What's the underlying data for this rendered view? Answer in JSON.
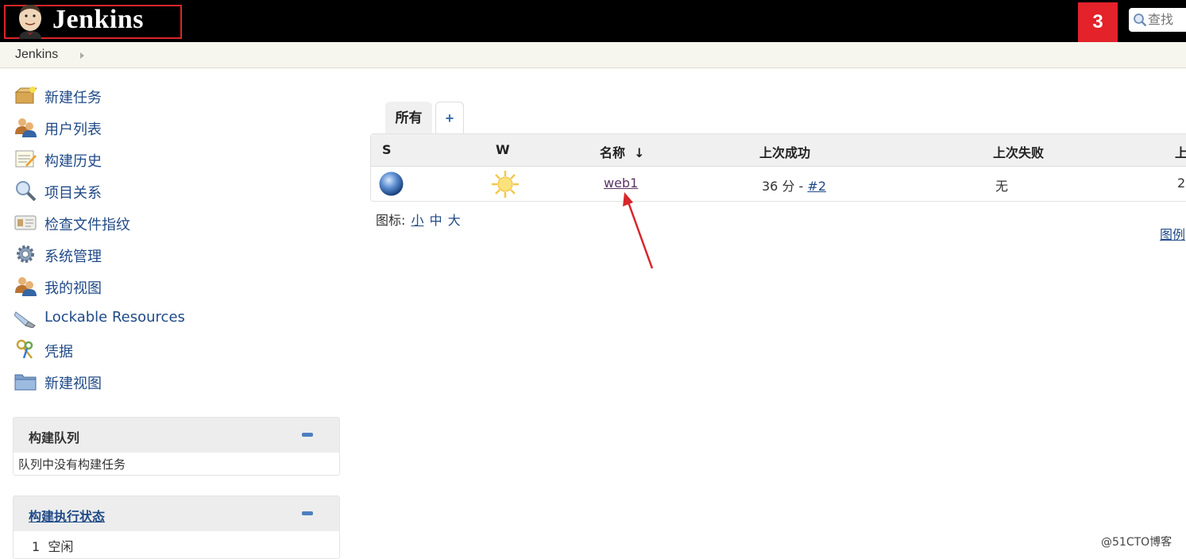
{
  "header": {
    "logo_text": "Jenkins",
    "notification_count": "3",
    "search_placeholder": "查找"
  },
  "breadcrumb": {
    "items": [
      "Jenkins"
    ]
  },
  "sidebar": {
    "items": [
      {
        "label": "新建任务",
        "icon": "new-item-icon"
      },
      {
        "label": "用户列表",
        "icon": "users-icon"
      },
      {
        "label": "构建历史",
        "icon": "build-history-icon"
      },
      {
        "label": "项目关系",
        "icon": "magnifier-icon"
      },
      {
        "label": "检查文件指纹",
        "icon": "fingerprint-card-icon"
      },
      {
        "label": "系统管理",
        "icon": "gear-icon"
      },
      {
        "label": "我的视图",
        "icon": "my-views-icon"
      },
      {
        "label": "Lockable Resources",
        "icon": "usb-drive-icon"
      },
      {
        "label": "凭据",
        "icon": "credentials-keys-icon"
      },
      {
        "label": "新建视图",
        "icon": "folder-icon"
      }
    ]
  },
  "build_queue": {
    "title": "构建队列",
    "empty_text": "队列中没有构建任务"
  },
  "executor_status": {
    "title": "构建执行状态",
    "executors": [
      {
        "number": "1",
        "state": "空闲"
      }
    ]
  },
  "view_tabs": {
    "active": "所有",
    "add": "+"
  },
  "job_table": {
    "headers": {
      "status": "S",
      "weather": "W",
      "name": "名称",
      "sort_arrow": "↓",
      "last_success": "上次成功",
      "last_failure": "上次失败",
      "last_duration": "上"
    },
    "rows": [
      {
        "status_icon": "blue-ball-icon",
        "weather_icon": "sun-icon",
        "name": "web1",
        "last_success_time": "36 分 - ",
        "last_success_build": "#2",
        "last_failure": "无",
        "last_duration": "2"
      }
    ]
  },
  "icon_size": {
    "label": "图标:",
    "small": "小",
    "medium": "中",
    "large": "大"
  },
  "legend_link": "图例",
  "watermark": "@51CTO博客",
  "colors": {
    "header_bg": "#000000",
    "notification_bg": "#e3222a",
    "link": "#204a87",
    "annotation_red": "#d9262b"
  }
}
